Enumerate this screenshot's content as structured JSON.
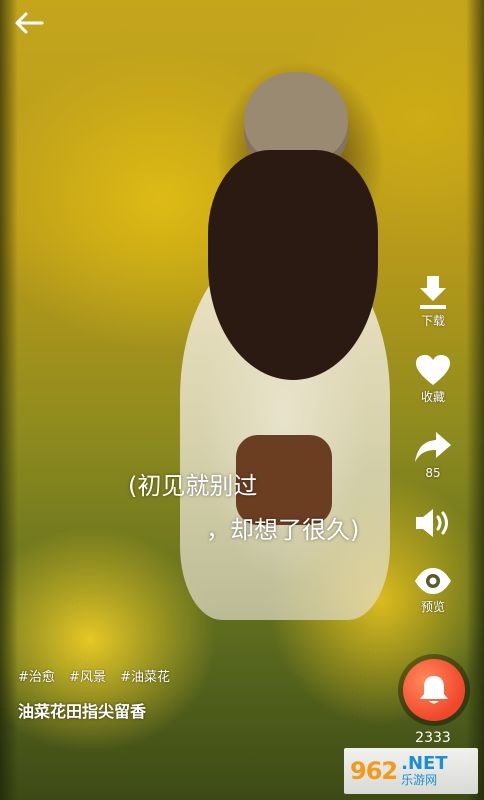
{
  "subtitles": {
    "line1": "(初见就别过",
    "line2": "，却想了很久)"
  },
  "side_actions": {
    "download": {
      "label": "下载",
      "icon": "download-icon"
    },
    "favorite": {
      "label": "收藏",
      "icon": "heart-icon"
    },
    "share": {
      "label": "85",
      "icon": "share-icon"
    },
    "volume": {
      "icon": "volume-icon"
    },
    "preview": {
      "label": "预览",
      "icon": "eye-icon"
    },
    "ringtone": {
      "count": "2333",
      "icon": "bell-icon",
      "color": "#f0462a"
    }
  },
  "tags": [
    "#治愈",
    "#风景",
    "#油菜花"
  ],
  "title": "油菜花田指尖留香",
  "watermark": {
    "number": "962",
    "domain": ".NET",
    "name": "乐游网"
  }
}
